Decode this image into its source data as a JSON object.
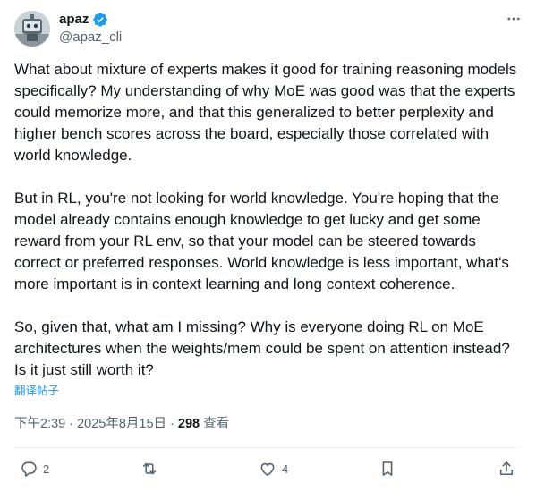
{
  "author": {
    "display_name": "apaz",
    "handle": "@apaz_cli",
    "verified": true,
    "avatar_icon": "robot-avatar"
  },
  "tweet": {
    "paragraphs": [
      "What about mixture of experts makes it good for training reasoning models specifically? My understanding of why MoE was good was that the experts could memorize more, and that this generalized to better perplexity and higher bench scores across the board, especially those correlated with world knowledge.",
      "But in RL, you're not looking for world knowledge. You're hoping that the model already contains enough knowledge to get lucky and get some reward from your RL env, so that your model can be steered towards correct or preferred responses. World knowledge is less important, what's more important is in context learning and long context coherence.",
      "So, given that, what am I missing? Why is everyone doing RL on MoE architectures when the weights/mem could be spent on attention instead? Is it just still worth it?"
    ],
    "translate_label": "翻译帖子"
  },
  "meta": {
    "time": "下午2:39",
    "separator": "·",
    "date": "2025年8月15日",
    "views": "298",
    "views_label": "查看"
  },
  "actions": {
    "reply_count": "2",
    "retweet_count": "",
    "like_count": "4"
  },
  "colors": {
    "link": "#1d9bf0",
    "secondary": "#536471",
    "text": "#0f1419",
    "verified": "#1d9bf0"
  }
}
